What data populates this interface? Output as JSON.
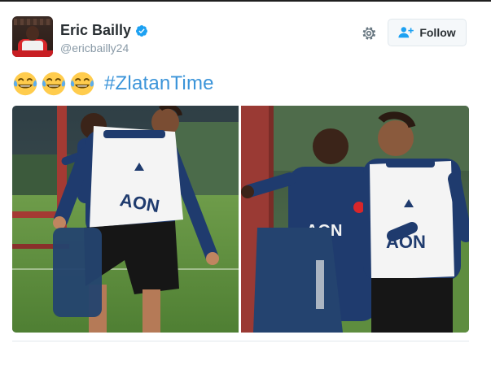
{
  "tweet": {
    "author": {
      "display_name": "Eric Bailly",
      "handle": "@ericbailly24",
      "verified": true,
      "avatar_icon": "profile-photo"
    },
    "actions": {
      "settings_icon": "gear-icon",
      "follow_label": "Follow",
      "follow_icon": "add-user-icon"
    },
    "text": {
      "emojis": [
        "face-with-tears-of-joy",
        "face-with-tears-of-joy",
        "face-with-tears-of-joy"
      ],
      "hashtag": "#ZlatanTime"
    },
    "media": {
      "photo_count": 2,
      "photos": [
        {
          "name": "training-photo-left",
          "jersey_text": "AON"
        },
        {
          "name": "training-photo-right",
          "jersey_text": "AON"
        }
      ]
    },
    "colors": {
      "link": "#3b94d9",
      "name": "#292f33",
      "handle": "#8899a6",
      "verified": "#1da1f2",
      "bib_white": "#f4f4f4",
      "kit_navy": "#1f3b6e",
      "grass": "#5e8d3f"
    }
  }
}
